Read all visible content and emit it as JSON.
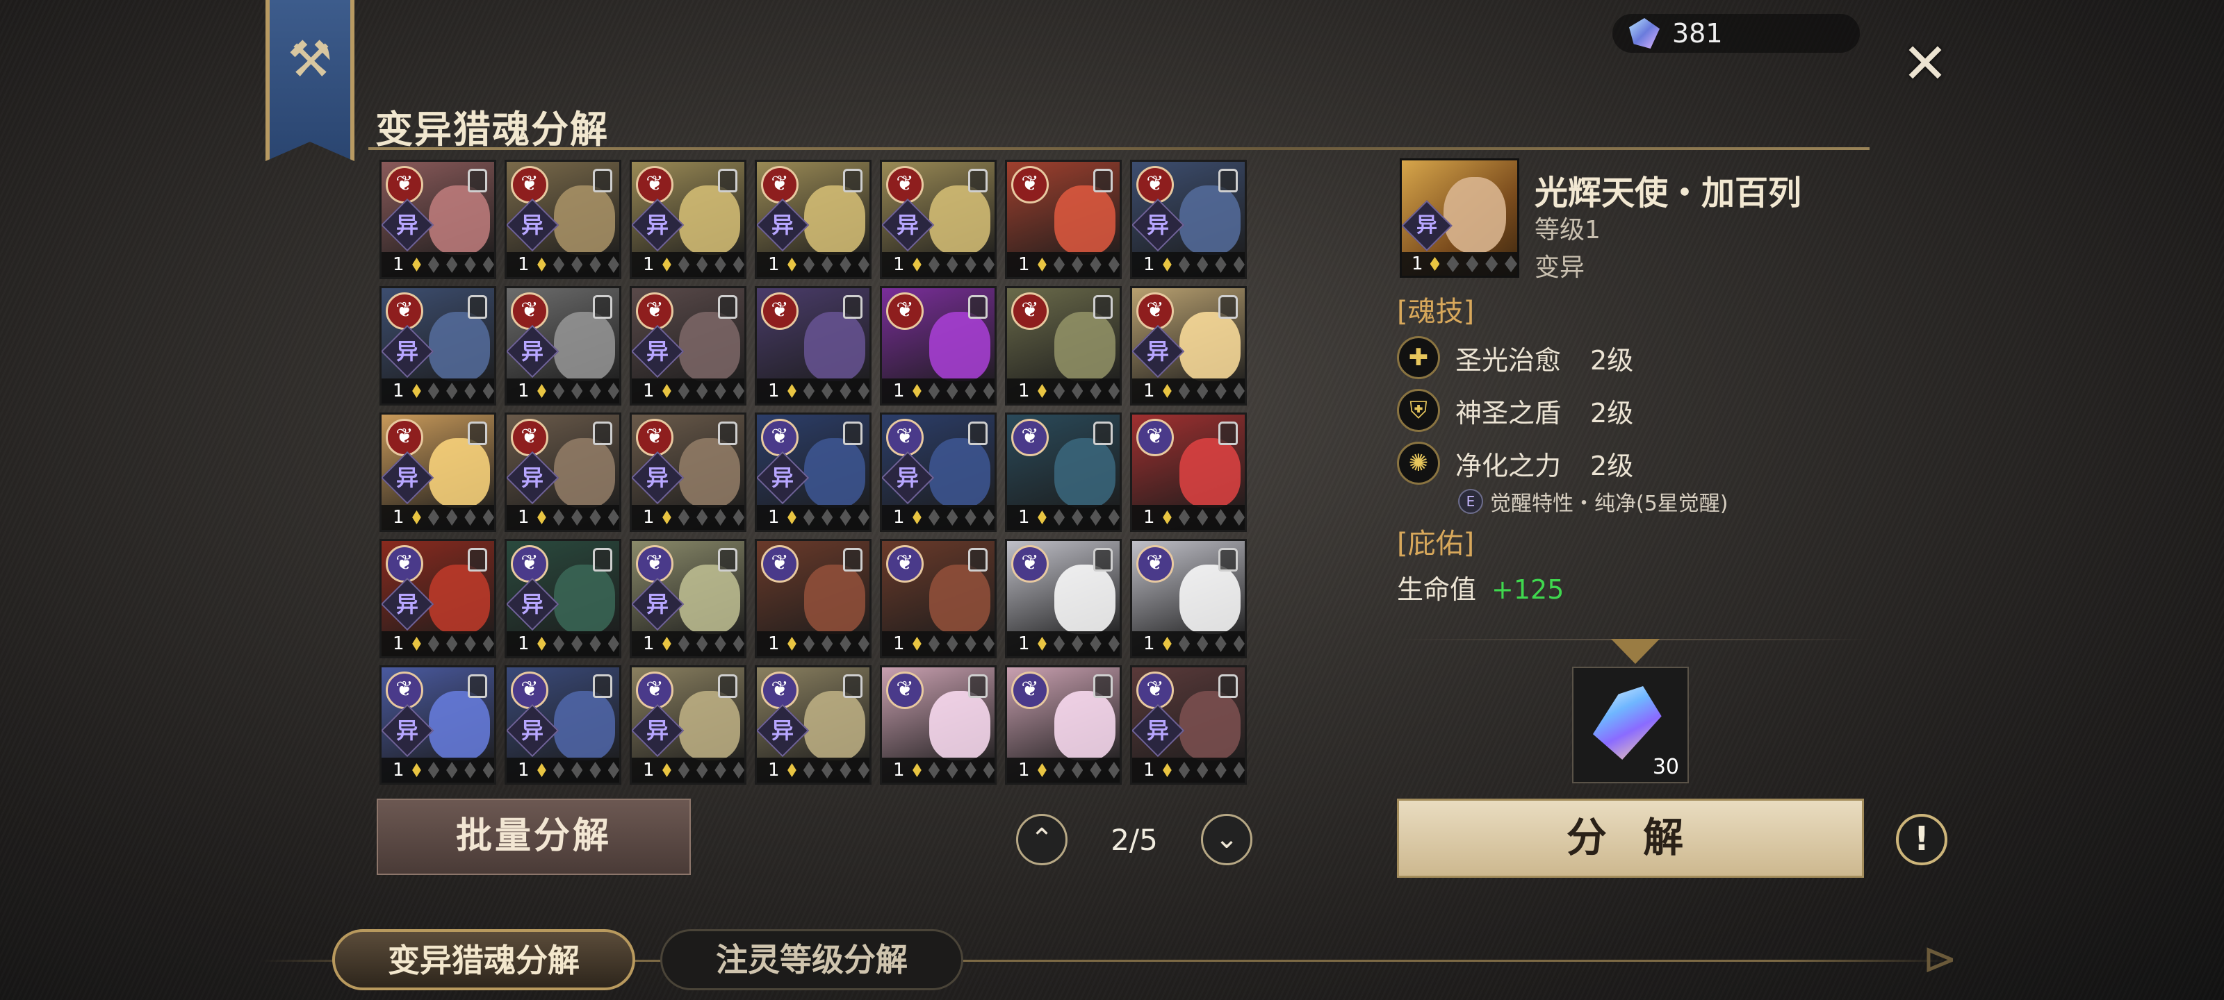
{
  "title": "变异猎魂分解",
  "currency": {
    "icon": "crystal-gem-icon",
    "amount": "381"
  },
  "close_icon": "close-icon",
  "pager": {
    "label": "2/5",
    "up_icon": "chevron-up-icon",
    "down_icon": "chevron-down-icon"
  },
  "grid": {
    "items": [
      {
        "level": "1",
        "class": "red",
        "yi": "异",
        "color": "#8a5a5a"
      },
      {
        "level": "1",
        "class": "red",
        "yi": "异",
        "color": "#7a6a4a"
      },
      {
        "level": "1",
        "class": "red",
        "yi": "异",
        "color": "#9a8a55"
      },
      {
        "level": "1",
        "class": "red",
        "yi": "异",
        "color": "#9a8a55"
      },
      {
        "level": "1",
        "class": "red",
        "yi": "异",
        "color": "#9a8a55"
      },
      {
        "level": "1",
        "class": "red",
        "yi": "",
        "color": "#a0402e"
      },
      {
        "level": "1",
        "class": "red",
        "yi": "异",
        "color": "#3d4e70"
      },
      {
        "level": "1",
        "class": "red",
        "yi": "异",
        "color": "#3d4e70"
      },
      {
        "level": "1",
        "class": "red",
        "yi": "异",
        "color": "#6c6c6c"
      },
      {
        "level": "1",
        "class": "red",
        "yi": "异",
        "color": "#5a4a4a"
      },
      {
        "level": "1",
        "class": "red",
        "yi": "",
        "color": "#4a3c6a"
      },
      {
        "level": "1",
        "class": "red",
        "yi": "",
        "color": "#7a2e9a"
      },
      {
        "level": "1",
        "class": "red",
        "yi": "",
        "color": "#6a6a4a"
      },
      {
        "level": "1",
        "class": "red",
        "yi": "异",
        "color": "#b8a070"
      },
      {
        "level": "1",
        "class": "red",
        "yi": "异",
        "color": "#c99a5a"
      },
      {
        "level": "1",
        "class": "red",
        "yi": "异",
        "color": "#6a5a4a"
      },
      {
        "level": "1",
        "class": "red",
        "yi": "异",
        "color": "#6a5a4a"
      },
      {
        "level": "1",
        "class": "purple",
        "yi": "异",
        "color": "#2c3e6a"
      },
      {
        "level": "1",
        "class": "purple",
        "yi": "异",
        "color": "#2c3e6a"
      },
      {
        "level": "1",
        "class": "purple",
        "yi": "",
        "color": "#2a4a5a"
      },
      {
        "level": "1",
        "class": "purple",
        "yi": "",
        "color": "#a03030"
      },
      {
        "level": "1",
        "class": "purple",
        "yi": "异",
        "color": "#8a2a1e"
      },
      {
        "level": "1",
        "class": "purple",
        "yi": "异",
        "color": "#2a4a3e"
      },
      {
        "level": "1",
        "class": "purple",
        "yi": "异",
        "color": "#8a8a6a"
      },
      {
        "level": "1",
        "class": "purple",
        "yi": "",
        "color": "#6a3a2a"
      },
      {
        "level": "1",
        "class": "purple",
        "yi": "",
        "color": "#6a3a2a"
      },
      {
        "level": "1",
        "class": "purple",
        "yi": "",
        "color": "#c0c0c8"
      },
      {
        "level": "1",
        "class": "purple",
        "yi": "",
        "color": "#c0c0c8"
      },
      {
        "level": "1",
        "class": "purple",
        "yi": "异",
        "color": "#4a5aa0"
      },
      {
        "level": "1",
        "class": "purple",
        "yi": "异",
        "color": "#3a4a7a"
      },
      {
        "level": "1",
        "class": "purple",
        "yi": "异",
        "color": "#8a8060"
      },
      {
        "level": "1",
        "class": "purple",
        "yi": "异",
        "color": "#8a8060"
      },
      {
        "level": "1",
        "class": "purple",
        "yi": "",
        "color": "#c9a0b0"
      },
      {
        "level": "1",
        "class": "purple",
        "yi": "",
        "color": "#c9a0b0"
      },
      {
        "level": "1",
        "class": "purple",
        "yi": "异",
        "color": "#5a3a3a"
      }
    ]
  },
  "selected": {
    "name": "光辉天使・加百列",
    "level_label": "等级1",
    "type_label": "变异",
    "portrait_level": "1",
    "portrait_yi": "异"
  },
  "sections": {
    "skills_title": "[魂技]",
    "blessing_title": "[庇佑]"
  },
  "skills": [
    {
      "icon": "holy-heal-icon",
      "glyph": "✚",
      "name": "圣光治愈",
      "level": "2级"
    },
    {
      "icon": "holy-shield-icon",
      "glyph": "⛨",
      "name": "神圣之盾",
      "level": "2级"
    },
    {
      "icon": "purify-icon",
      "glyph": "✺",
      "name": "净化之力",
      "level": "2级"
    }
  ],
  "awake": {
    "icon": "awaken-icon",
    "glyph": "E",
    "text": "觉醒特性・纯净(5星觉醒)"
  },
  "stat": {
    "label": "生命值",
    "value": "+125"
  },
  "reward": {
    "icon": "crystal-gem-icon",
    "count": "30"
  },
  "buttons": {
    "batch": "批量分解",
    "decompose": "分 解",
    "info_icon": "info-icon",
    "info_glyph": "!"
  },
  "tabs": [
    {
      "label": "变异猎魂分解",
      "active": true
    },
    {
      "label": "注灵等级分解",
      "active": false
    }
  ],
  "colors": {
    "accent_gold": "#cdb88f",
    "stat_green": "#3fd84e",
    "section_orange": "#d8a85b"
  }
}
